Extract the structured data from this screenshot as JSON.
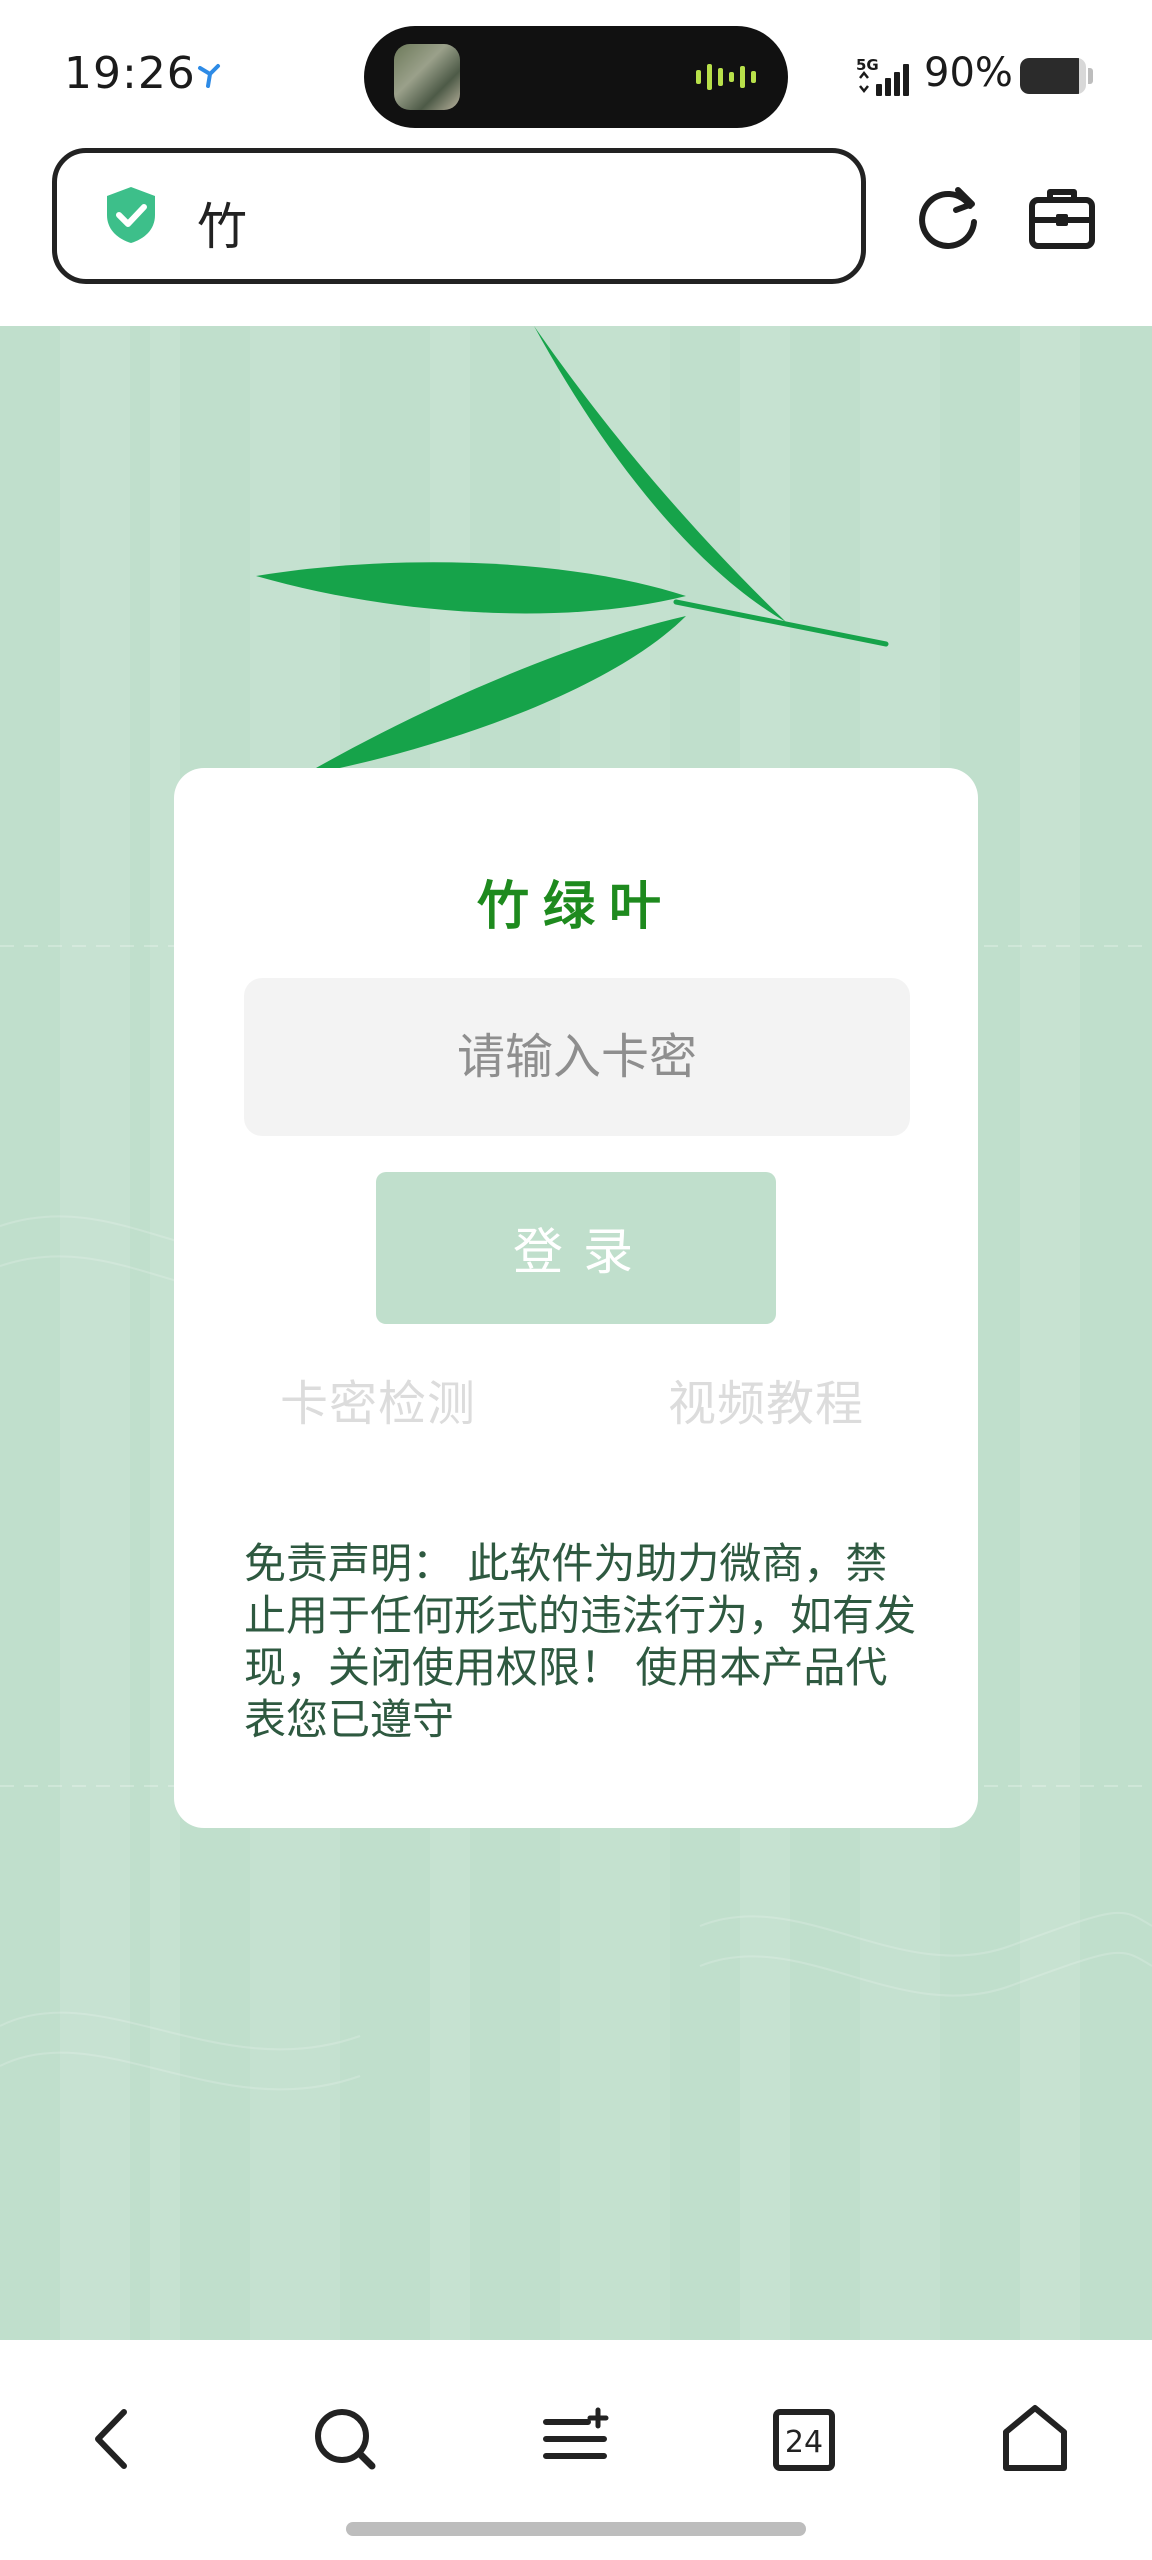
{
  "status_bar": {
    "time": "19:26",
    "network": "5G",
    "battery_text": "90%",
    "battery_level": 0.9
  },
  "browser": {
    "url_text": "竹",
    "security_icon": "shield-check-icon",
    "colors": {
      "shield": "#3dbf8a"
    }
  },
  "page": {
    "title": "竹绿叶",
    "input_placeholder": "请输入卡密",
    "login_label": "登录",
    "link_check": "卡密检测",
    "link_video": "视频教程",
    "disclaimer": "免责声明： 此软件为助力微商，禁止用于任何形式的违法行为，如有发现，关闭使用权限！ 使用本产品代表您已遵守",
    "colors": {
      "background": "#c0dfcc",
      "title": "#1e8a1e",
      "leaf": "#16a34a",
      "button": "#c0dfcc"
    }
  },
  "bottom_nav": {
    "tabs_count": "24",
    "items": [
      "back-icon",
      "search-icon",
      "menu-icon",
      "tabs-icon",
      "home-icon"
    ]
  }
}
